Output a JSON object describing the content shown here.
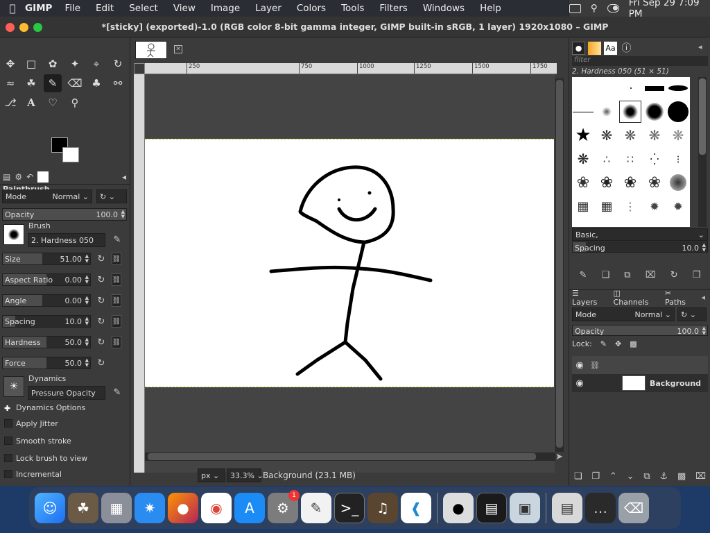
{
  "menubar": {
    "app": "GIMP",
    "items": [
      "File",
      "Edit",
      "Select",
      "View",
      "Image",
      "Layer",
      "Colors",
      "Tools",
      "Filters",
      "Windows",
      "Help"
    ],
    "clock": "Fri Sep 29  7:09 PM"
  },
  "window": {
    "title": "*[sticky] (exported)-1.0 (RGB color 8-bit gamma integer, GIMP built-in sRGB, 1 layer) 1920x1080 – GIMP"
  },
  "tool_options": {
    "title": "Paintbrush",
    "mode_label": "Mode",
    "mode_value": "Normal",
    "opacity": {
      "label": "Opacity",
      "value": "100.0"
    },
    "brush_label": "Brush",
    "brush_value": "2. Hardness 050",
    "size": {
      "label": "Size",
      "value": "51.00"
    },
    "aspect": {
      "label": "Aspect Ratio",
      "value": "0.00"
    },
    "angle": {
      "label": "Angle",
      "value": "0.00"
    },
    "spacing": {
      "label": "Spacing",
      "value": "10.0"
    },
    "hardness": {
      "label": "Hardness",
      "value": "50.0"
    },
    "force": {
      "label": "Force",
      "value": "50.0"
    },
    "dynamics_label": "Dynamics",
    "dynamics_value": "Pressure Opacity",
    "dynamics_options": "Dynamics Options",
    "apply_jitter": "Apply Jitter",
    "smooth_stroke": "Smooth stroke",
    "lock_brush": "Lock brush to view",
    "incremental": "Incremental"
  },
  "canvas": {
    "ruler_ticks": [
      "250",
      "750",
      "1000",
      "1250",
      "1500",
      "1750"
    ],
    "unit": "px",
    "zoom": "33.3%",
    "status": "Background (23.1 MB)"
  },
  "brushes": {
    "filter_placeholder": "filter",
    "selected": "2. Hardness 050 (51 × 51)",
    "preset": "Basic,",
    "spacing_label": "Spacing",
    "spacing_value": "10.0"
  },
  "layers": {
    "tabs": [
      "Layers",
      "Channels",
      "Paths"
    ],
    "mode_label": "Mode",
    "mode_value": "Normal",
    "opacity_label": "Opacity",
    "opacity_value": "100.0",
    "lock_label": "Lock:",
    "layer_name": "Background"
  }
}
